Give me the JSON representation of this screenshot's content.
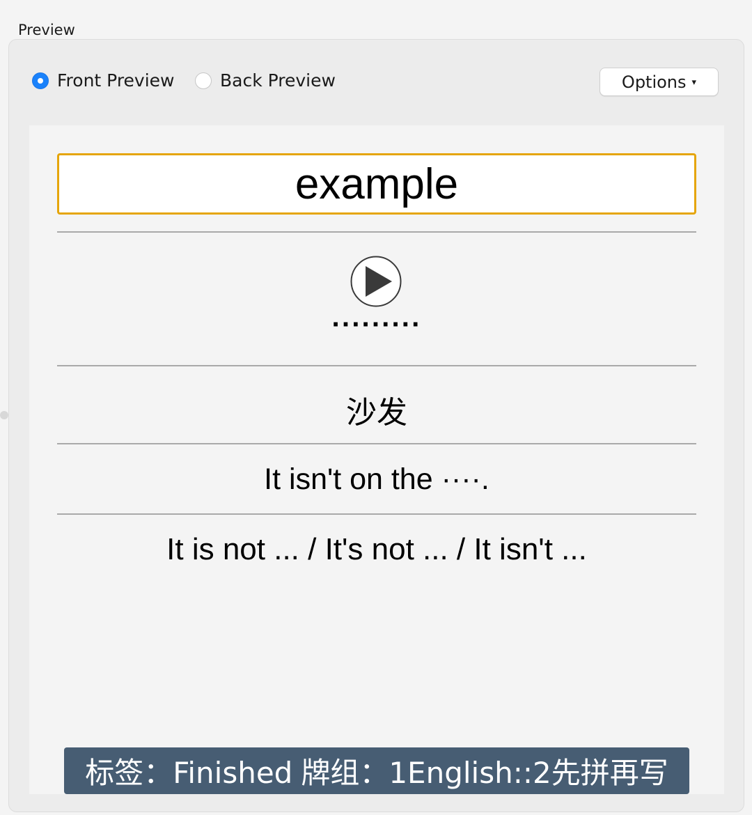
{
  "section": {
    "title": "Preview"
  },
  "preview_mode": {
    "options": [
      {
        "label": "Front Preview",
        "selected": true
      },
      {
        "label": "Back Preview",
        "selected": false
      }
    ]
  },
  "options_button": {
    "label": "Options",
    "caret": "▾"
  },
  "card": {
    "word": "example",
    "phonetic": "·········",
    "meaning": "沙发",
    "sentence": "It isn't on the ····.",
    "note": "It is not ... / It's not ... / It isn't ...",
    "tags_label": "标签：Finished",
    "deck_label": "牌组：1English::2先拼再写",
    "accent_color": "#e5a50a",
    "tag_bar_color": "#475d73"
  },
  "icons": {
    "play": "play-icon"
  }
}
